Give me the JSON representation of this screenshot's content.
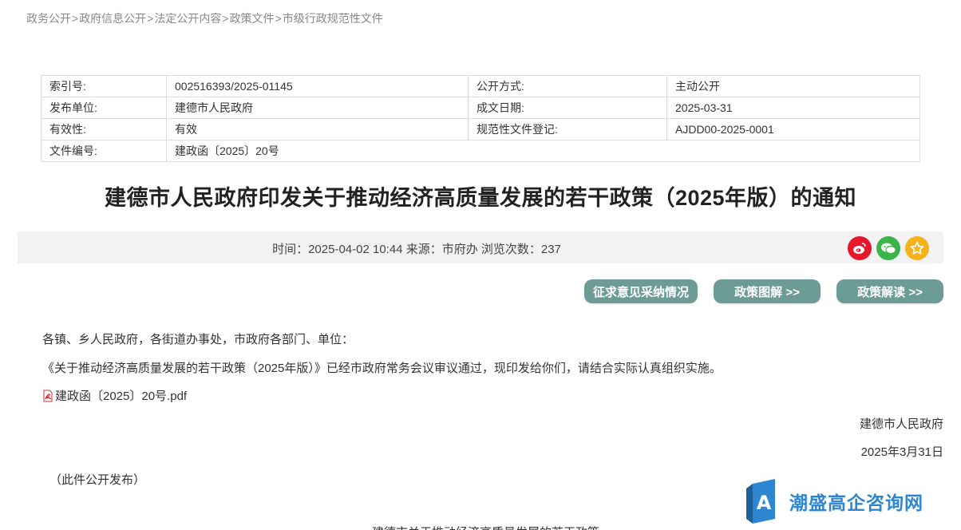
{
  "breadcrumb": [
    "政务公开",
    "政府信息公开",
    "法定公开内容",
    "政策文件",
    "市级行政规范性文件"
  ],
  "breadcrumb_sep": ">",
  "meta": {
    "index_label": "索引号:",
    "index_value": "002516393/2025-01145",
    "open_mode_label": "公开方式:",
    "open_mode_value": "主动公开",
    "publisher_label": "发布单位:",
    "publisher_value": "建德市人民政府",
    "date_label": "成文日期:",
    "date_value": "2025-03-31",
    "validity_label": "有效性:",
    "validity_value": "有效",
    "reg_label": "规范性文件登记:",
    "reg_value": "AJDD00-2025-0001",
    "doc_no_label": "文件编号:",
    "doc_no_value": "建政函〔2025〕20号"
  },
  "title": "建德市人民政府印发关于推动经济高质量发展的若干政策（2025年版）的通知",
  "info_bar": {
    "text": "时间：2025-04-02 10:44 来源：市府办 浏览次数：237"
  },
  "buttons": {
    "feedback": "征求意见采纳情况",
    "graphic": "政策图解 >>",
    "interpret": "政策解读 >>"
  },
  "content": {
    "salutation": "各镇、乡人民政府，各街道办事处，市政府各部门、单位：",
    "body": "《关于推动经济高质量发展的若干政策（2025年版）》已经市政府常务会议审议通过，现印发给你们，请结合实际认真组织实施。",
    "attachment": "建政函〔2025〕20号.pdf",
    "signature": "建德市人民政府",
    "sign_date": "2025年3月31日",
    "note": "（此件公开发布）",
    "next_heading": "建德市关于推动经济高质量发展的若干政策"
  },
  "watermark": {
    "text": "潮盛高企咨询网",
    "logo_letter": "A"
  },
  "colors": {
    "button_bg": "#6d9c96",
    "weibo": "#e6162d",
    "wechat": "#3bb54a",
    "favorite": "#f5b21b",
    "watermark": "#2e86d1"
  }
}
